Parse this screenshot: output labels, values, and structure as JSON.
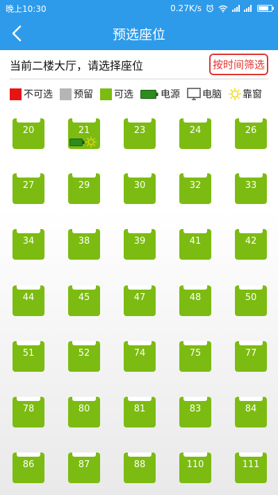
{
  "status_bar": {
    "time": "晚上10:30",
    "speed": "0.27K/s",
    "icons": [
      "alarm-icon",
      "wifi-icon",
      "signal-icon",
      "signal-icon",
      "battery-icon"
    ],
    "battery_level": 0.8
  },
  "header": {
    "title": "预选座位",
    "back_icon": "chevron-left-icon"
  },
  "hall": {
    "text": "当前二楼大厅，请选择座位",
    "filter_label": "按时间筛选"
  },
  "legend": [
    {
      "label": "不可选",
      "color": "#e81414",
      "kind": "square"
    },
    {
      "label": "预留",
      "color": "#b5b5b5",
      "kind": "square"
    },
    {
      "label": "可选",
      "color": "#7cbb11",
      "kind": "square"
    },
    {
      "label": "电源",
      "color": "#2e8b1e",
      "kind": "battery-icon"
    },
    {
      "label": "电脑",
      "color": "#555555",
      "kind": "monitor-icon"
    },
    {
      "label": "靠窗",
      "color": "#f1d60e",
      "kind": "sun-icon"
    }
  ],
  "colors": {
    "primary": "#2e9bea",
    "available": "#7cbb11",
    "filter": "#e0342f"
  },
  "seats": [
    [
      "20",
      "21",
      "23",
      "24",
      "26"
    ],
    [
      "27",
      "29",
      "30",
      "32",
      "33"
    ],
    [
      "34",
      "38",
      "39",
      "41",
      "42"
    ],
    [
      "44",
      "45",
      "47",
      "48",
      "50"
    ],
    [
      "51",
      "52",
      "74",
      "75",
      "77"
    ],
    [
      "78",
      "80",
      "81",
      "83",
      "84"
    ],
    [
      "86",
      "87",
      "88",
      "110",
      "111"
    ]
  ],
  "seat_features": {
    "21": [
      "battery-icon",
      "sun-icon"
    ]
  }
}
